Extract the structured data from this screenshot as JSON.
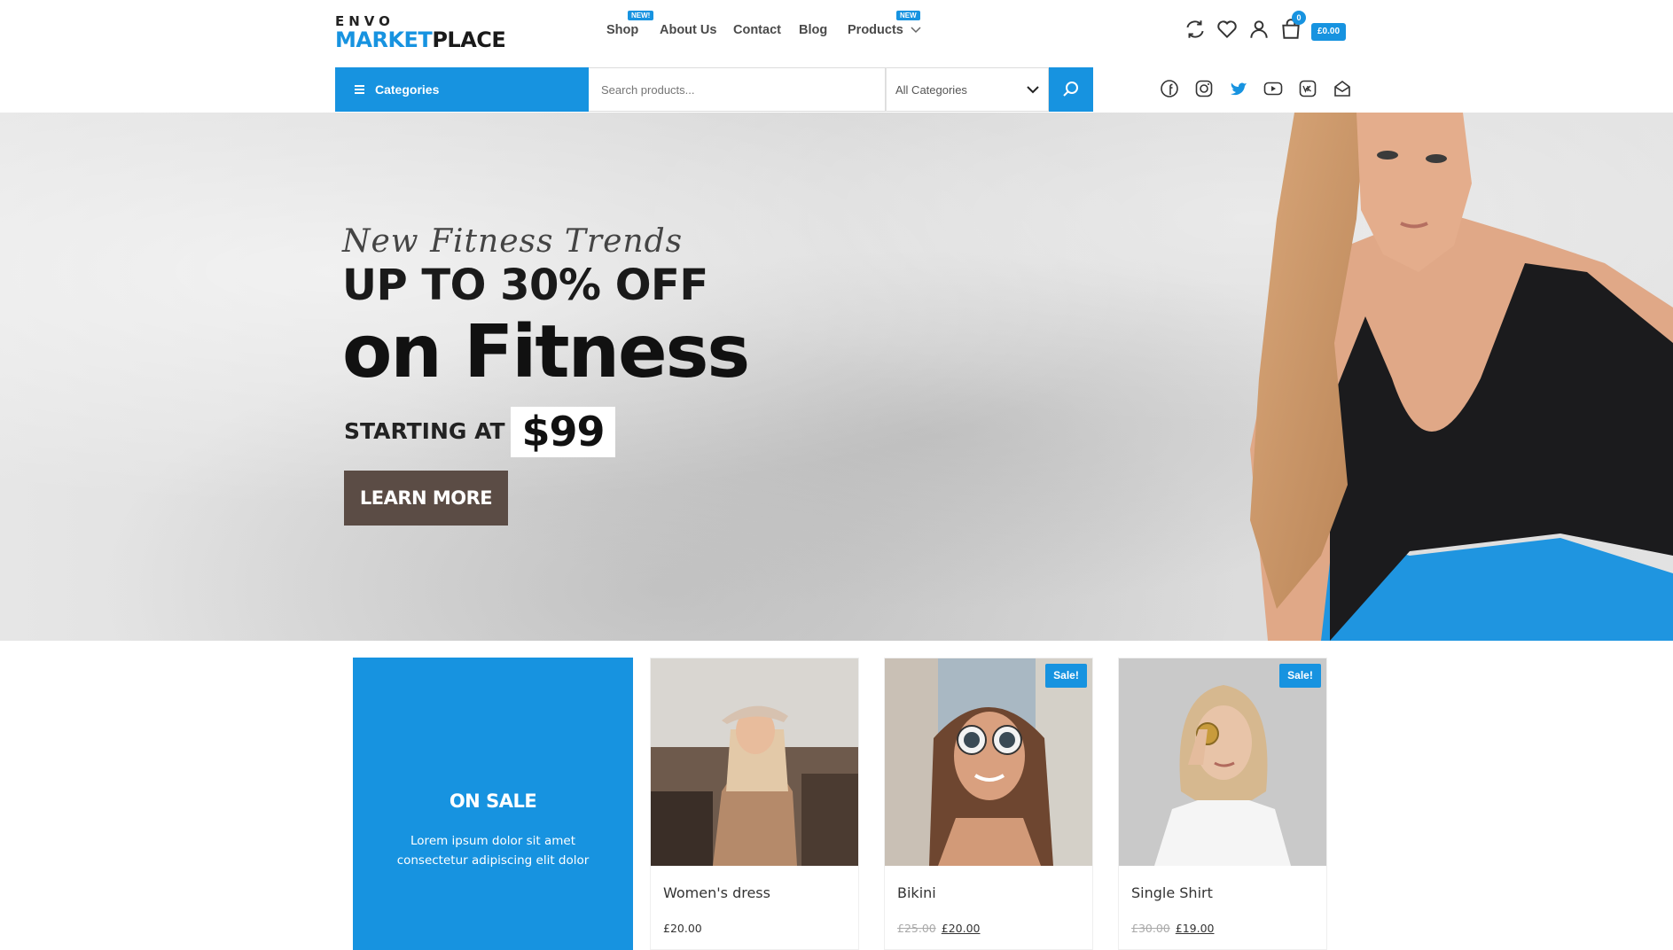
{
  "brand": {
    "top": "ENVO",
    "left": "MARKET",
    "right": "PLACE"
  },
  "nav": [
    {
      "label": "Shop",
      "badge": "NEW!"
    },
    {
      "label": "About Us"
    },
    {
      "label": "Contact"
    },
    {
      "label": "Blog"
    },
    {
      "label": "Products",
      "badge": "NEW"
    }
  ],
  "header_icons": [
    "compare-icon",
    "wishlist-icon",
    "account-icon",
    "cart-icon"
  ],
  "cart": {
    "count": "0",
    "total": "£0.00"
  },
  "search": {
    "categories_label": "Categories",
    "placeholder": "Search products...",
    "category_select": "All Categories"
  },
  "social_icons": [
    "facebook-icon",
    "instagram-icon",
    "twitter-icon",
    "youtube-icon",
    "vk-icon",
    "email-icon"
  ],
  "hero": {
    "subtitle": "New Fitness Trends",
    "headline_1": "UP TO 30% OFF",
    "headline_2": "on Fitness",
    "starting_label": "STARTING AT",
    "price": "$99",
    "button": "LEARN MORE"
  },
  "promo": {
    "title": "ON SALE",
    "text": "Lorem ipsum dolor sit amet consectetur adipiscing elit dolor"
  },
  "products": [
    {
      "name": "Women's dress",
      "price": "£20.00",
      "old_price": "",
      "sale": ""
    },
    {
      "name": "Bikini",
      "price": "£20.00",
      "old_price": "£25.00",
      "sale": "Sale!"
    },
    {
      "name": "Single Shirt",
      "price": "£19.00",
      "old_price": "£30.00",
      "sale": "Sale!"
    }
  ],
  "colors": {
    "accent": "#1793e0",
    "button_brown": "#5b4c45"
  }
}
